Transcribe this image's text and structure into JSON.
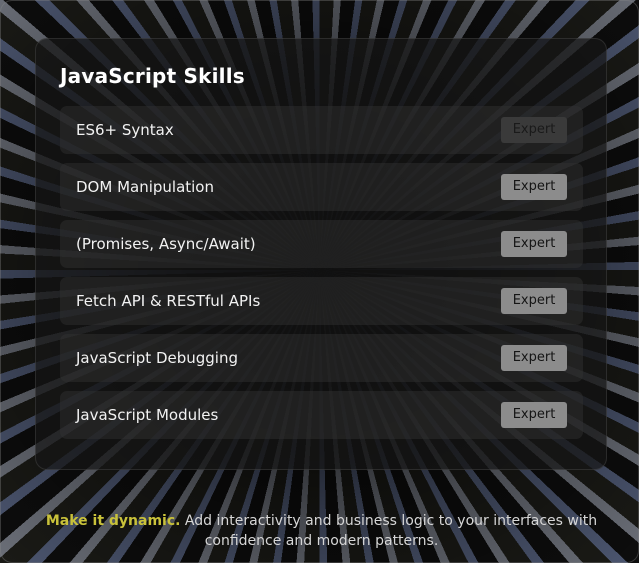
{
  "card": {
    "title": "JavaScript Skills"
  },
  "skills": [
    {
      "name": "ES6+ Syntax",
      "level": "Expert"
    },
    {
      "name": "DOM Manipulation",
      "level": "Expert"
    },
    {
      "name": "(Promises, Async/Await)",
      "level": "Expert"
    },
    {
      "name": "Fetch API & RESTful APIs",
      "level": "Expert"
    },
    {
      "name": "JavaScript Debugging",
      "level": "Expert"
    },
    {
      "name": "JavaScript Modules",
      "level": "Expert"
    }
  ],
  "footer": {
    "accent": "Make it dynamic.",
    "text": " Add interactivity and business logic to your interfaces with confidence and modern patterns."
  },
  "colors": {
    "accent": "#c9c23a",
    "badge": "#8c8c8c",
    "card_background": "#161616"
  }
}
